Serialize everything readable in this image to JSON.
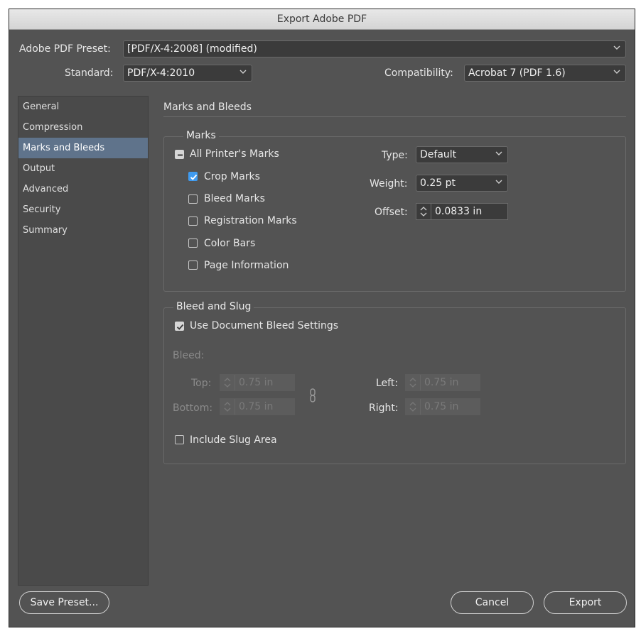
{
  "window": {
    "title": "Export Adobe PDF"
  },
  "preset": {
    "label": "Adobe PDF Preset:",
    "value": "[PDF/X-4:2008] (modified)"
  },
  "standard": {
    "label": "Standard:",
    "value": "PDF/X-4:2010"
  },
  "compatibility": {
    "label": "Compatibility:",
    "value": "Acrobat 7 (PDF 1.6)"
  },
  "sidebar": {
    "items": [
      {
        "label": "General"
      },
      {
        "label": "Compression"
      },
      {
        "label": "Marks and Bleeds"
      },
      {
        "label": "Output"
      },
      {
        "label": "Advanced"
      },
      {
        "label": "Security"
      },
      {
        "label": "Summary"
      }
    ],
    "selected": "Marks and Bleeds"
  },
  "panel": {
    "title": "Marks and Bleeds"
  },
  "marks": {
    "title": "Marks",
    "all_printers_marks": {
      "label": "All Printer's Marks",
      "state": "mixed"
    },
    "crop_marks": {
      "label": "Crop Marks",
      "checked": true
    },
    "bleed_marks": {
      "label": "Bleed Marks",
      "checked": false
    },
    "registration_marks": {
      "label": "Registration Marks",
      "checked": false
    },
    "color_bars": {
      "label": "Color Bars",
      "checked": false
    },
    "page_information": {
      "label": "Page Information",
      "checked": false
    },
    "type": {
      "label": "Type:",
      "value": "Default"
    },
    "weight": {
      "label": "Weight:",
      "value": "0.25 pt"
    },
    "offset": {
      "label": "Offset:",
      "value": "0.0833 in"
    }
  },
  "bleed_slug": {
    "title": "Bleed and Slug",
    "use_document_bleed": {
      "label": "Use Document Bleed Settings",
      "checked": true
    },
    "bleed_label": "Bleed:",
    "top": {
      "label": "Top:",
      "value": "0.75 in"
    },
    "bottom": {
      "label": "Bottom:",
      "value": "0.75 in"
    },
    "left": {
      "label": "Left:",
      "value": "0.75 in"
    },
    "right": {
      "label": "Right:",
      "value": "0.75 in"
    },
    "include_slug": {
      "label": "Include Slug Area",
      "checked": false
    }
  },
  "buttons": {
    "save_preset": "Save Preset...",
    "cancel": "Cancel",
    "export": "Export"
  },
  "colors": {
    "window_bg": "#535353",
    "selection": "#5f738b",
    "checkbox_accent": "#3f9bf0"
  }
}
